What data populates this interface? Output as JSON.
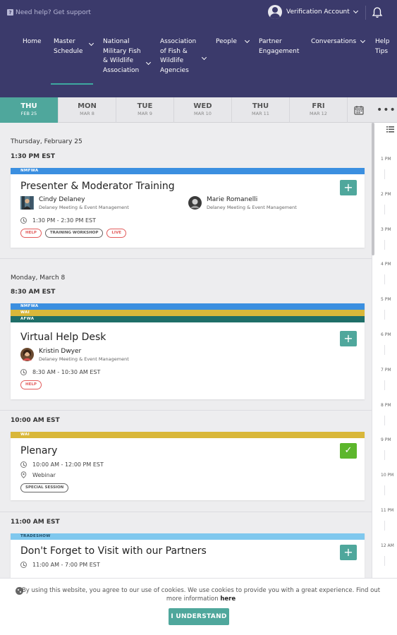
{
  "topbar": {
    "help_text": "Need help? Get support",
    "account_label": "Verification Account"
  },
  "nav": {
    "items": [
      {
        "label": "Home"
      },
      {
        "label": "Master Schedule",
        "active": true
      },
      {
        "label": "National Military Fish & Wildlife Association"
      },
      {
        "label": "Association of Fish & Wildlife Agencies"
      },
      {
        "label": "People"
      },
      {
        "label": "Partner Engagement"
      },
      {
        "label": "Conversations"
      },
      {
        "label": "Help Tips"
      }
    ]
  },
  "date_tabs": [
    {
      "day": "THU",
      "date": "FEB 25",
      "active": true
    },
    {
      "day": "MON",
      "date": "MAR 8"
    },
    {
      "day": "TUE",
      "date": "MAR 9"
    },
    {
      "day": "WED",
      "date": "MAR 10"
    },
    {
      "day": "THU",
      "date": "MAR 11"
    },
    {
      "day": "FRI",
      "date": "MAR 12"
    }
  ],
  "schedule": {
    "day1": {
      "label": "Thursday, February 25",
      "time": "1:30 PM EST",
      "event": {
        "bands": [
          {
            "label": "NMFWA",
            "color": "#3b8fe0"
          }
        ],
        "title": "Presenter & Moderator Training",
        "people": [
          {
            "name": "Cindy Delaney",
            "org": "Delaney Meeting & Event Management"
          },
          {
            "name": "Marie Romanelli",
            "org": "Delaney Meeting & Event Management"
          }
        ],
        "time": "1:30 PM - 2:30 PM EST",
        "tags": [
          "HELP",
          "TRAINING WORKSHOP",
          "LIVE"
        ],
        "action": "+"
      }
    },
    "day2": {
      "label": "Monday, March 8",
      "time": "8:30 AM EST",
      "event": {
        "bands": [
          {
            "label": "NMFWA",
            "color": "#3b8fe0"
          },
          {
            "label": "WAI",
            "color": "#d9b73a"
          },
          {
            "label": "AFWA",
            "color": "#1f6e68"
          }
        ],
        "title": "Virtual Help Desk",
        "people": [
          {
            "name": "Kristin Dwyer",
            "org": "Delaney Meeting & Event Management"
          }
        ],
        "time": "8:30 AM - 10:30 AM EST",
        "tags": [
          "HELP"
        ],
        "action": "+"
      }
    },
    "slot3": {
      "time": "10:00 AM EST",
      "event": {
        "bands": [
          {
            "label": "WAI",
            "color": "#d9b73a"
          }
        ],
        "title": "Plenary",
        "time": "10:00 AM - 12:00 PM EST",
        "location": "Webinar",
        "tags": [
          "SPECIAL SESSION"
        ],
        "action": "✓"
      }
    },
    "slot4": {
      "time": "11:00 AM EST",
      "event": {
        "bands": [
          {
            "label": "TRADESHOW",
            "color": "#7fc8ee"
          }
        ],
        "title": "Don't Forget to Visit with our Partners",
        "time": "11:00 AM - 7:00 PM EST",
        "action": "+"
      }
    }
  },
  "rail_hours": [
    "1 PM",
    "2 PM",
    "3 PM",
    "4 PM",
    "5 PM",
    "6 PM",
    "7 PM",
    "8 PM",
    "9 PM",
    "10 PM",
    "11 PM",
    "12 AM"
  ],
  "cookie": {
    "text_before": "By using this website, you agree to our use of cookies. We use cookies to provide you with a great experience. Find out more information",
    "link": "here",
    "button": "I UNDERSTAND"
  },
  "colors": {
    "nav_bg": "#3b3a6b",
    "accent": "#4fa79c",
    "done": "#5cb62c",
    "tag_red": "#e25b5b"
  }
}
